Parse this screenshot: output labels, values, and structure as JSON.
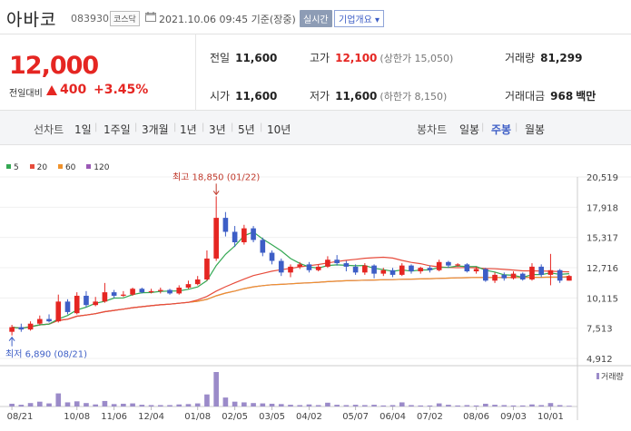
{
  "header": {
    "name": "아바코",
    "code": "083930",
    "market": "코스닥",
    "time": "2021.10.06 09:45 기준(장중)",
    "realtime": "실시간",
    "info": "기업개요 ▾"
  },
  "summary": {
    "price": "12,000",
    "change_label": "전일대비",
    "change": "400",
    "change_pct": "+3.45%",
    "prev_close_label": "전일",
    "prev_close": "11,600",
    "high_label": "고가",
    "high": "12,100",
    "upper_limit": "(상한가 15,050)",
    "volume_label": "거래량",
    "volume": "81,299",
    "open_label": "시가",
    "open": "11,600",
    "low_label": "저가",
    "low": "11,600",
    "lower_limit": "(하한가 8,150)",
    "trade_amount_label": "거래대금",
    "trade_amount": "968",
    "trade_amount_unit": "백만"
  },
  "periods": {
    "line_chart_label": "선차트",
    "line_items": [
      "1일",
      "1주일",
      "3개월",
      "1년",
      "3년",
      "5년",
      "10년"
    ],
    "candle_chart_label": "봉차트",
    "candle_items": [
      "일봉",
      "주봉",
      "월봉"
    ],
    "selected_candle": "주봉"
  },
  "colors": {
    "up": "#e52622",
    "down": "#3d5ec6",
    "ma5": "#34a853",
    "ma20": "#e74c3c",
    "ma60": "#f0922b",
    "ma120": "#9b59b6",
    "volume": "#9b8bc9"
  },
  "chart_data": {
    "type": "candlestick",
    "legend": [
      {
        "name": "5",
        "color": "#34a853"
      },
      {
        "name": "20",
        "color": "#e74c3c"
      },
      {
        "name": "60",
        "color": "#f0922b"
      },
      {
        "name": "120",
        "color": "#9b59b6"
      }
    ],
    "y_ticks": [
      4912,
      7513,
      10115,
      12716,
      15317,
      17918,
      20519
    ],
    "y_tick_labels": [
      "4,912",
      "7,513",
      "10,115",
      "12,716",
      "15,317",
      "17,918",
      "20,519"
    ],
    "ylim": [
      4912,
      20519
    ],
    "x_ticks": [
      {
        "label": "08/21",
        "index": 0
      },
      {
        "label": "10/08",
        "index": 7
      },
      {
        "label": "11/06",
        "index": 11
      },
      {
        "label": "12/04",
        "index": 15
      },
      {
        "label": "01/08",
        "index": 20
      },
      {
        "label": "02/05",
        "index": 24
      },
      {
        "label": "03/05",
        "index": 28
      },
      {
        "label": "04/02",
        "index": 32
      },
      {
        "label": "05/07",
        "index": 37
      },
      {
        "label": "06/04",
        "index": 41
      },
      {
        "label": "07/02",
        "index": 45
      },
      {
        "label": "08/06",
        "index": 50
      },
      {
        "label": "09/03",
        "index": 54
      },
      {
        "label": "10/01",
        "index": 58
      }
    ],
    "high_annotation": "최고 18,850 (01/22)",
    "high_index": 22,
    "high_value": 18850,
    "low_annotation": "최저 6,890 (08/21)",
    "low_index": 0,
    "low_value": 6890,
    "volume_label": "거래량",
    "candles": [
      {
        "o": 7200,
        "c": 7600,
        "h": 7800,
        "l": 6890,
        "v": 8
      },
      {
        "o": 7600,
        "c": 7400,
        "h": 7900,
        "l": 7200,
        "v": 5
      },
      {
        "o": 7400,
        "c": 7900,
        "h": 8100,
        "l": 7300,
        "v": 10
      },
      {
        "o": 7900,
        "c": 8300,
        "h": 8600,
        "l": 7800,
        "v": 14
      },
      {
        "o": 8300,
        "c": 8100,
        "h": 8700,
        "l": 8000,
        "v": 9
      },
      {
        "o": 8100,
        "c": 9800,
        "h": 10400,
        "l": 8000,
        "v": 38
      },
      {
        "o": 9800,
        "c": 8900,
        "h": 10000,
        "l": 8700,
        "v": 12
      },
      {
        "o": 8800,
        "c": 10300,
        "h": 10600,
        "l": 8700,
        "v": 15
      },
      {
        "o": 10300,
        "c": 9500,
        "h": 10700,
        "l": 9300,
        "v": 10
      },
      {
        "o": 9500,
        "c": 9800,
        "h": 10200,
        "l": 9400,
        "v": 6
      },
      {
        "o": 9800,
        "c": 10600,
        "h": 11400,
        "l": 9700,
        "v": 16
      },
      {
        "o": 10600,
        "c": 10300,
        "h": 10800,
        "l": 10100,
        "v": 7
      },
      {
        "o": 10300,
        "c": 10400,
        "h": 10700,
        "l": 10200,
        "v": 8
      },
      {
        "o": 10400,
        "c": 10900,
        "h": 11000,
        "l": 10300,
        "v": 9
      },
      {
        "o": 10900,
        "c": 10600,
        "h": 11000,
        "l": 10500,
        "v": 5
      },
      {
        "o": 10600,
        "c": 10700,
        "h": 10900,
        "l": 10500,
        "v": 4
      },
      {
        "o": 10700,
        "c": 10800,
        "h": 11000,
        "l": 10500,
        "v": 4
      },
      {
        "o": 10800,
        "c": 10500,
        "h": 10900,
        "l": 10400,
        "v": 4
      },
      {
        "o": 10500,
        "c": 11000,
        "h": 11200,
        "l": 10400,
        "v": 6
      },
      {
        "o": 11000,
        "c": 11300,
        "h": 11600,
        "l": 10900,
        "v": 7
      },
      {
        "o": 11300,
        "c": 11700,
        "h": 12000,
        "l": 11200,
        "v": 9
      },
      {
        "o": 11700,
        "c": 13500,
        "h": 14200,
        "l": 11600,
        "v": 35
      },
      {
        "o": 13500,
        "c": 17000,
        "h": 18850,
        "l": 13300,
        "v": 100
      },
      {
        "o": 17000,
        "c": 15800,
        "h": 17500,
        "l": 15400,
        "v": 26
      },
      {
        "o": 15800,
        "c": 14900,
        "h": 16300,
        "l": 14500,
        "v": 14
      },
      {
        "o": 14900,
        "c": 16100,
        "h": 16400,
        "l": 14700,
        "v": 12
      },
      {
        "o": 16100,
        "c": 15100,
        "h": 16300,
        "l": 14900,
        "v": 10
      },
      {
        "o": 15100,
        "c": 14000,
        "h": 15300,
        "l": 13700,
        "v": 9
      },
      {
        "o": 14000,
        "c": 13300,
        "h": 14200,
        "l": 13000,
        "v": 8
      },
      {
        "o": 13300,
        "c": 12300,
        "h": 13500,
        "l": 12000,
        "v": 7
      },
      {
        "o": 12300,
        "c": 12800,
        "h": 13000,
        "l": 11900,
        "v": 5
      },
      {
        "o": 12800,
        "c": 13000,
        "h": 13200,
        "l": 12600,
        "v": 4
      },
      {
        "o": 13000,
        "c": 12500,
        "h": 13200,
        "l": 12300,
        "v": 6
      },
      {
        "o": 12500,
        "c": 12800,
        "h": 13000,
        "l": 12400,
        "v": 4
      },
      {
        "o": 12800,
        "c": 13400,
        "h": 13700,
        "l": 12700,
        "v": 11
      },
      {
        "o": 13400,
        "c": 13100,
        "h": 13800,
        "l": 12900,
        "v": 5
      },
      {
        "o": 13100,
        "c": 12800,
        "h": 13300,
        "l": 12400,
        "v": 4
      },
      {
        "o": 12800,
        "c": 12300,
        "h": 13000,
        "l": 12100,
        "v": 5
      },
      {
        "o": 12300,
        "c": 12900,
        "h": 13100,
        "l": 12100,
        "v": 4
      },
      {
        "o": 12900,
        "c": 12200,
        "h": 13000,
        "l": 11800,
        "v": 5
      },
      {
        "o": 12200,
        "c": 12500,
        "h": 12700,
        "l": 12000,
        "v": 3
      },
      {
        "o": 12500,
        "c": 12100,
        "h": 12700,
        "l": 11900,
        "v": 4
      },
      {
        "o": 12100,
        "c": 12900,
        "h": 13100,
        "l": 12000,
        "v": 12
      },
      {
        "o": 12900,
        "c": 12400,
        "h": 13000,
        "l": 12200,
        "v": 4
      },
      {
        "o": 12400,
        "c": 12700,
        "h": 12800,
        "l": 12200,
        "v": 3
      },
      {
        "o": 12700,
        "c": 12500,
        "h": 12900,
        "l": 12300,
        "v": 3
      },
      {
        "o": 12500,
        "c": 13200,
        "h": 13400,
        "l": 12400,
        "v": 9
      },
      {
        "o": 13200,
        "c": 12900,
        "h": 13300,
        "l": 12700,
        "v": 5
      },
      {
        "o": 12900,
        "c": 13000,
        "h": 13100,
        "l": 12800,
        "v": 3
      },
      {
        "o": 13000,
        "c": 12400,
        "h": 13100,
        "l": 12300,
        "v": 4
      },
      {
        "o": 12400,
        "c": 12600,
        "h": 12800,
        "l": 12200,
        "v": 3
      },
      {
        "o": 12600,
        "c": 11600,
        "h": 12700,
        "l": 11500,
        "v": 8
      },
      {
        "o": 11600,
        "c": 12100,
        "h": 12300,
        "l": 11400,
        "v": 5
      },
      {
        "o": 12100,
        "c": 11800,
        "h": 12300,
        "l": 11600,
        "v": 4
      },
      {
        "o": 11800,
        "c": 12200,
        "h": 12400,
        "l": 11700,
        "v": 3
      },
      {
        "o": 12200,
        "c": 11700,
        "h": 12300,
        "l": 11600,
        "v": 3
      },
      {
        "o": 11700,
        "c": 12800,
        "h": 13100,
        "l": 11600,
        "v": 6
      },
      {
        "o": 12800,
        "c": 12100,
        "h": 13000,
        "l": 11900,
        "v": 4
      },
      {
        "o": 12100,
        "c": 12500,
        "h": 13900,
        "l": 11200,
        "v": 10
      },
      {
        "o": 12500,
        "c": 11600,
        "h": 12600,
        "l": 11400,
        "v": 4
      },
      {
        "o": 11600,
        "c": 12000,
        "h": 12100,
        "l": 11600,
        "v": 2
      }
    ]
  }
}
